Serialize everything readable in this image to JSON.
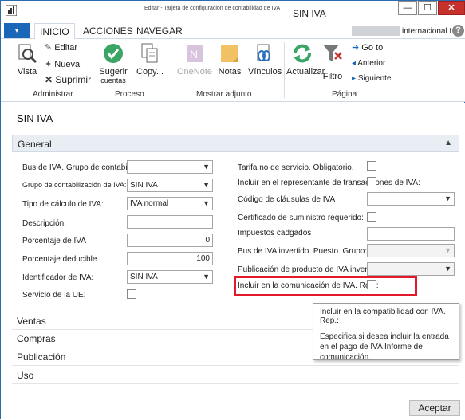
{
  "window": {
    "subtitle": "Editar - Tarjeta de configuración de contabilidad de IVA",
    "title": "SIN IVA",
    "min_icon": "minimize-icon",
    "max_icon": "maximize-icon",
    "close_icon": "close-icon"
  },
  "tabs": {
    "menu": "▾",
    "items": [
      "INICIO",
      "ACCIONES",
      "NAVEGAR"
    ],
    "company": "internacional Ltd.",
    "help": "?"
  },
  "ribbon": {
    "administrar": {
      "label": "Administrar",
      "vista": "Vista",
      "editar": "Editar",
      "nueva": "Nueva",
      "suprimir": "Suprimir"
    },
    "proceso": {
      "label": "Proceso",
      "sugerir": "Sugerir",
      "sugerir_sub": "cuentas",
      "copy": "Copy..."
    },
    "adjunto": {
      "label": "Mostrar adjunto",
      "onenote": "OneNote",
      "notas": "Notas",
      "vinculos": "Vínculos"
    },
    "pagina": {
      "label": "Página",
      "actualizar": "Actualizar",
      "filtro": "Filtro",
      "goto": "Go to",
      "anterior": "Anterior",
      "siguiente": "Siguiente"
    }
  },
  "page_title": "SIN IVA",
  "general": {
    "header": "General",
    "left": [
      {
        "label": "Bus de IVA. Grupo de contabilización:",
        "value": "",
        "type": "select"
      },
      {
        "label": "Grupo de contabilización de IVA:",
        "value": "SIN IVA",
        "type": "select"
      },
      {
        "label": "Tipo de cálculo de IVA:",
        "value": "IVA normal",
        "type": "select"
      },
      {
        "label": "Descripción:",
        "value": "",
        "type": "text"
      },
      {
        "label": "Porcentaje de IVA",
        "value": "0",
        "type": "number"
      },
      {
        "label": "Porcentaje deducible",
        "value": "100",
        "type": "number"
      },
      {
        "label": "Identificador de IVA:",
        "value": "SIN IVA",
        "type": "select"
      },
      {
        "label": "Servicio de la UE:",
        "value": "",
        "type": "checkbox"
      }
    ],
    "right": [
      {
        "label": "Tarifa no de servicio. Obligatorio.",
        "type": "checkbox"
      },
      {
        "label": "Incluir en el representante de transacciones de IVA:",
        "type": "checkbox"
      },
      {
        "label": "Código de cláusulas de IVA",
        "value": "",
        "type": "select"
      },
      {
        "label": "Certificado de suministro requerido:",
        "type": "checkbox"
      },
      {
        "label": "Impuestos cadgados",
        "value": "",
        "type": "text"
      },
      {
        "label": "Bus de IVA invertido. Puesto. Grupo:",
        "value": "",
        "type": "select-disabled"
      },
      {
        "label": "Publicación de producto de IVA invertido:",
        "value": "",
        "type": "select-disabled"
      },
      {
        "label": "Incluir en la comunicación de IVA. Rep.:",
        "type": "checkbox"
      }
    ]
  },
  "tooltip": {
    "title": "Incluir en la compatibilidad con IVA. Rep.:",
    "body": "Especifica si desea incluir la entrada en el pago de IVA Informe de comunicación."
  },
  "fasttabs": [
    "Ventas",
    "Compras",
    "Publicación",
    "Uso"
  ],
  "accept": "Aceptar",
  "colors": {
    "accent": "#1a66b8",
    "highlight": "#e3182a",
    "close": "#c7312b"
  }
}
